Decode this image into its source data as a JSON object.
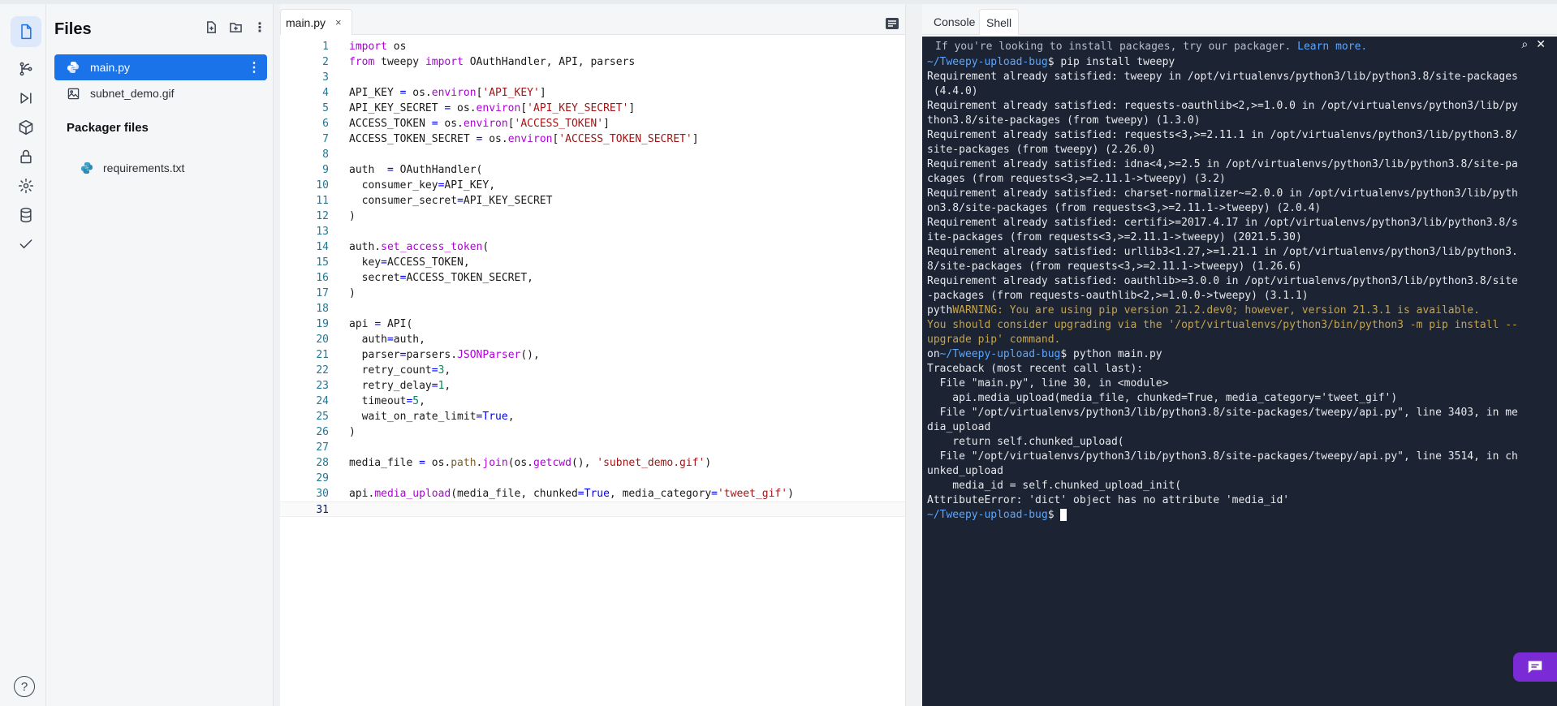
{
  "files_panel": {
    "title": "Files",
    "files": [
      {
        "name": "main.py",
        "icon": "python-icon"
      },
      {
        "name": "subnet_demo.gif",
        "icon": "image-icon"
      }
    ],
    "packager_title": "Packager files",
    "packager_files": [
      {
        "name": "requirements.txt",
        "icon": "python-icon"
      }
    ],
    "help_label": "?"
  },
  "editor": {
    "tab_label": "main.py",
    "close_label": "×",
    "lines": [
      "import os",
      "from tweepy import OAuthHandler, API, parsers",
      "",
      "API_KEY = os.environ['API_KEY']",
      "API_KEY_SECRET = os.environ['API_KEY_SECRET']",
      "ACCESS_TOKEN = os.environ['ACCESS_TOKEN']",
      "ACCESS_TOKEN_SECRET = os.environ['ACCESS_TOKEN_SECRET']",
      "",
      "auth  = OAuthHandler(",
      "  consumer_key=API_KEY,",
      "  consumer_secret=API_KEY_SECRET",
      ")",
      "",
      "auth.set_access_token(",
      "  key=ACCESS_TOKEN,",
      "  secret=ACCESS_TOKEN_SECRET,",
      ")",
      "",
      "api = API(",
      "  auth=auth,",
      "  parser=parsers.JSONParser(),",
      "  retry_count=3,",
      "  retry_delay=1,",
      "  timeout=5,",
      "  wait_on_rate_limit=True,",
      ")",
      "",
      "media_file = os.path.join(os.getcwd(), 'subnet_demo.gif')",
      "",
      "api.media_upload(media_file, chunked=True, media_category='tweet_gif')",
      ""
    ],
    "current_line": 31
  },
  "right_pane": {
    "tabs": [
      "Console",
      "Shell"
    ],
    "active_tab": "Shell",
    "notice_text": "If you're looking to install packages, try our packager.",
    "notice_link": "Learn more.",
    "terminal_lines": [
      {
        "prompt": "~/Tweepy-upload-bug",
        "text": "$ pip install tweepy"
      },
      {
        "text": "Requirement already satisfied: tweepy in /opt/virtualenvs/python3/lib/python3.8/site-packages"
      },
      {
        "text": " (4.4.0)"
      },
      {
        "text": "Requirement already satisfied: requests-oauthlib<2,>=1.0.0 in /opt/virtualenvs/python3/lib/py"
      },
      {
        "text": "thon3.8/site-packages (from tweepy) (1.3.0)"
      },
      {
        "text": "Requirement already satisfied: requests<3,>=2.11.1 in /opt/virtualenvs/python3/lib/python3.8/"
      },
      {
        "text": "site-packages (from tweepy) (2.26.0)"
      },
      {
        "text": "Requirement already satisfied: idna<4,>=2.5 in /opt/virtualenvs/python3/lib/python3.8/site-pa"
      },
      {
        "text": "ckages (from requests<3,>=2.11.1->tweepy) (3.2)"
      },
      {
        "text": "Requirement already satisfied: charset-normalizer~=2.0.0 in /opt/virtualenvs/python3/lib/pyth"
      },
      {
        "text": "on3.8/site-packages (from requests<3,>=2.11.1->tweepy) (2.0.4)"
      },
      {
        "text": "Requirement already satisfied: certifi>=2017.4.17 in /opt/virtualenvs/python3/lib/python3.8/s"
      },
      {
        "text": "ite-packages (from requests<3,>=2.11.1->tweepy) (2021.5.30)"
      },
      {
        "text": "Requirement already satisfied: urllib3<1.27,>=1.21.1 in /opt/virtualenvs/python3/lib/python3."
      },
      {
        "text": "8/site-packages (from requests<3,>=2.11.1->tweepy) (1.26.6)"
      },
      {
        "text": "Requirement already satisfied: oauthlib>=3.0.0 in /opt/virtualenvs/python3/lib/python3.8/site"
      },
      {
        "text": "-packages (from requests-oauthlib<2,>=1.0.0->tweepy) (3.1.1)"
      },
      {
        "lead": "pyth",
        "warn": "WARNING: You are using pip version 21.2.dev0; however, version 21.3.1 is available."
      },
      {
        "warn": "You should consider upgrading via the '/opt/virtualenvs/python3/bin/python3 -m pip install --"
      },
      {
        "warn": "upgrade pip' command."
      },
      {
        "lead": "on",
        "prompt": "~/Tweepy-upload-bug",
        "text": "$ python main.py"
      },
      {
        "text": "Traceback (most recent call last):"
      },
      {
        "text": "  File \"main.py\", line 30, in <module>"
      },
      {
        "text": "    api.media_upload(media_file, chunked=True, media_category='tweet_gif')"
      },
      {
        "text": "  File \"/opt/virtualenvs/python3/lib/python3.8/site-packages/tweepy/api.py\", line 3403, in me"
      },
      {
        "text": "dia_upload"
      },
      {
        "text": "    return self.chunked_upload("
      },
      {
        "text": "  File \"/opt/virtualenvs/python3/lib/python3.8/site-packages/tweepy/api.py\", line 3514, in ch"
      },
      {
        "text": "unked_upload"
      },
      {
        "text": "    media_id = self.chunked_upload_init("
      },
      {
        "text": "AttributeError: 'dict' object has no attribute 'media_id'"
      },
      {
        "prompt": "~/Tweepy-upload-bug",
        "text": "$ ",
        "cursor": true
      }
    ]
  },
  "colors": {
    "accent": "#1a73e8",
    "terminal_bg": "#1c2333",
    "prompt": "#5aa6ff",
    "warning": "#c7a44a",
    "chat": "#7a2bd6"
  }
}
